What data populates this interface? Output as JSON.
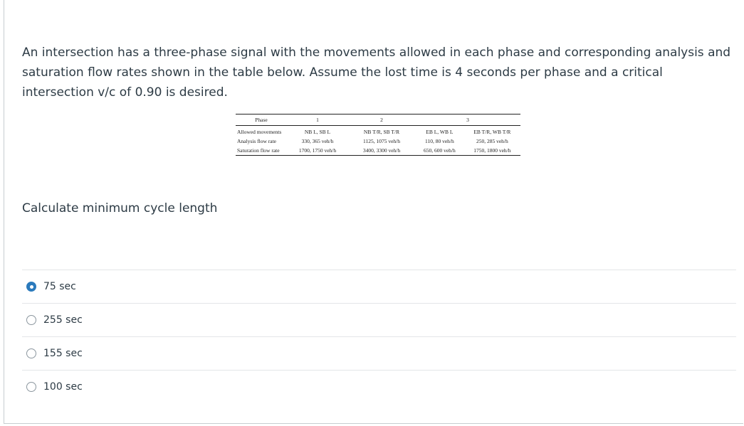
{
  "question": {
    "text": "An intersection has a three-phase signal with the movements allowed in each phase and corresponding analysis and saturation flow rates shown in the table below. Assume the lost time is 4 seconds per phase and a critical intersection v/c of 0.90 is desired.",
    "prompt": "Calculate minimum cycle length"
  },
  "table": {
    "headers": [
      "Phase",
      "1",
      "2",
      "3"
    ],
    "rows": [
      {
        "label": "Allowed movements",
        "cells": [
          "NB L, SB L",
          "NB T/R, SB T/R",
          "EB L, WB L",
          "EB T/R, WB T/R"
        ]
      },
      {
        "label": "Analysis flow rate",
        "cells": [
          "330, 365 veh/h",
          "1125, 1075 veh/h",
          "110, 80 veh/h",
          "250, 285 veh/h"
        ]
      },
      {
        "label": "Saturation flow rate",
        "cells": [
          "1700, 1750 veh/h",
          "3400, 3300 veh/h",
          "650, 600 veh/h",
          "1750, 1800 veh/h"
        ]
      }
    ]
  },
  "answers": [
    {
      "label": "75 sec",
      "selected": true
    },
    {
      "label": "255 sec",
      "selected": false
    },
    {
      "label": "155 sec",
      "selected": false
    },
    {
      "label": "100 sec",
      "selected": false
    }
  ],
  "colors": {
    "text": "#2d3b45",
    "radio_selected": "#2b7abc",
    "divider": "#e3e6e8"
  }
}
